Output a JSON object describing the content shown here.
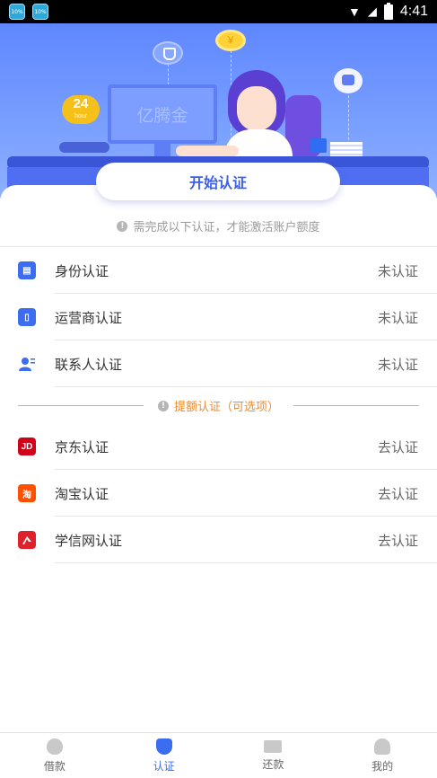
{
  "status_bar": {
    "time": "4:41",
    "app_icon_1": "10%",
    "app_icon_2": "10%"
  },
  "hero": {
    "monitor_text": "亿腾金",
    "clock_badge": "24",
    "clock_sub": "hour",
    "coin_symbol": "￥"
  },
  "start_button": {
    "label": "开始认证"
  },
  "notice": {
    "icon": "info-icon",
    "text": "需完成以下认证，才能激活账户额度"
  },
  "required_items": [
    {
      "label": "身份认证",
      "status": "未认证",
      "icon": "id-card-icon"
    },
    {
      "label": "运营商认证",
      "status": "未认证",
      "icon": "phone-icon"
    },
    {
      "label": "联系人认证",
      "status": "未认证",
      "icon": "contacts-icon"
    }
  ],
  "optional_header": {
    "text": "提额认证（可选项）",
    "color": "#f08a2c"
  },
  "optional_items": [
    {
      "label": "京东认证",
      "status": "去认证",
      "icon": "jd-icon",
      "icon_text": "JD"
    },
    {
      "label": "淘宝认证",
      "status": "去认证",
      "icon": "taobao-icon",
      "icon_text": "淘"
    },
    {
      "label": "学信网认证",
      "status": "去认证",
      "icon": "xuexin-icon",
      "icon_text": ""
    }
  ],
  "tabbar": {
    "tabs": [
      {
        "label": "借款",
        "icon": "loan-icon",
        "active": false
      },
      {
        "label": "认证",
        "icon": "shield-check-icon",
        "active": true
      },
      {
        "label": "还款",
        "icon": "card-icon",
        "active": false
      },
      {
        "label": "我的",
        "icon": "user-icon",
        "active": false
      }
    ]
  },
  "colors": {
    "accent": "#3c6cf0",
    "optional": "#f08a2c",
    "hero_top": "#5f87ff"
  }
}
